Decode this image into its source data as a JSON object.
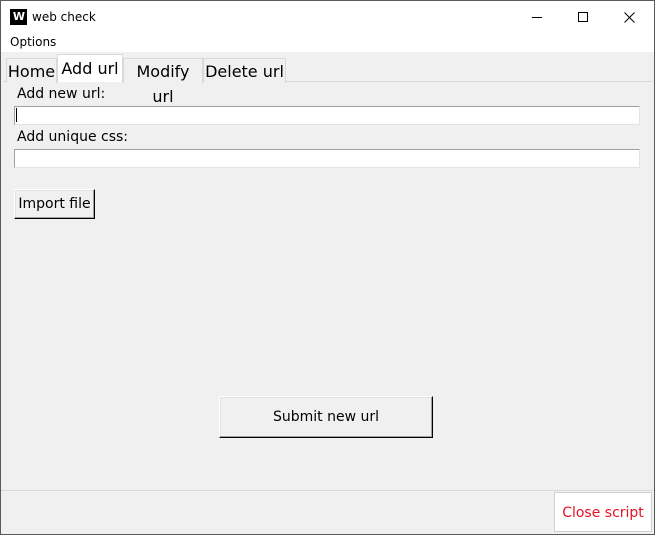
{
  "window": {
    "title": "web check",
    "icon_text": "W",
    "controls": [
      "minimize-icon",
      "maximize-icon",
      "close-icon"
    ]
  },
  "menu": {
    "items": [
      {
        "label": "Options"
      }
    ]
  },
  "tabs": [
    {
      "label": "Home",
      "selected": false
    },
    {
      "label": "Add url",
      "selected": true
    },
    {
      "label": "Modify url",
      "selected": false
    },
    {
      "label": "Delete url",
      "selected": false
    }
  ],
  "add_url_panel": {
    "url_label": "Add new url:",
    "url_value": "",
    "css_label": "Add unique css:",
    "css_value": "",
    "import_button": "Import file",
    "submit_button": "Submit new url"
  },
  "footer": {
    "close_button": "Close script",
    "close_color": "#e81123"
  }
}
